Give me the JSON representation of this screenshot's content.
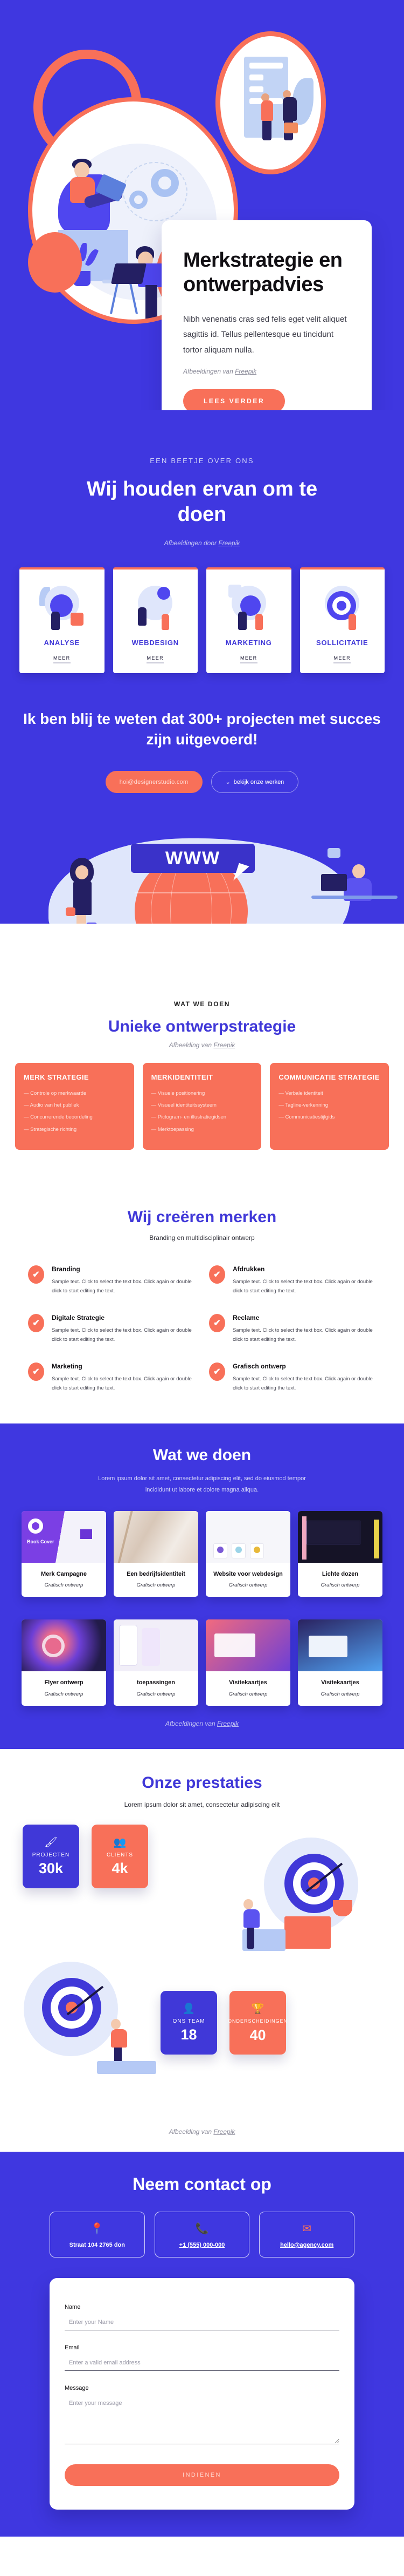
{
  "hero": {
    "title": "Merkstrategie en ontwerpadvies",
    "paragraph": "Nibh venenatis cras sed felis eget velit aliquet sagittis id. Tellus pellentesque eu tincidunt tortor aliquam nulla.",
    "credit_prefix": "Afbeeldingen van ",
    "credit_link": "Freepik",
    "cta_label": "LEES VERDER"
  },
  "about": {
    "eyebrow": "EEN BEETJE OVER ONS",
    "title": "Wij houden ervan om te doen",
    "credit_prefix": "Afbeeldingen door ",
    "credit_link": "Freepik",
    "services": [
      {
        "name": "ANALYSE",
        "more": "MEER"
      },
      {
        "name": "WEBDESIGN",
        "more": "MEER"
      },
      {
        "name": "MARKETING",
        "more": "MEER"
      },
      {
        "name": "SOLLICITATIE",
        "more": "MEER"
      }
    ]
  },
  "cta": {
    "title": "Ik ben blij te weten dat 300+ projecten met succes zijn uitgevoerd!",
    "email_button": "hoi@designerstudio.com",
    "works_button": "bekijk onze werken"
  },
  "www_band": {
    "wordmark": "WWW"
  },
  "strategy": {
    "eyebrow": "WAT WE DOEN",
    "title": "Unieke ontwerpstrategie",
    "credit_prefix": "Afbeelding van ",
    "credit_link": "Freepik",
    "cards": [
      {
        "title": "MERK STRATEGIE",
        "items": [
          "Controle op merkwaarde",
          "Audio van het publiek",
          "Concurrerende beoordeling",
          "Strategische richting"
        ]
      },
      {
        "title": "MERKIDENTITEIT",
        "items": [
          "Visuele positionering",
          "Visueel identiteitssysteem",
          "Pictogram- en illustratiegidsen",
          "Merktoepassing"
        ]
      },
      {
        "title": "COMMUNICATIE STRATEGIE",
        "items": [
          "Verbale identiteit",
          "Tagline-verkenning",
          "Communicatiestijlgids"
        ]
      }
    ]
  },
  "create": {
    "title": "Wij creëren merken",
    "subtitle": "Branding en multidisciplinair ontwerp",
    "body": "Sample text. Click to select the text box. Click again or double click to start editing the text.",
    "features": [
      {
        "title": "Branding"
      },
      {
        "title": "Afdrukken"
      },
      {
        "title": "Digitale Strategie"
      },
      {
        "title": "Reclame"
      },
      {
        "title": "Marketing"
      },
      {
        "title": "Grafisch ontwerp"
      }
    ]
  },
  "portfolio": {
    "title": "Wat we doen",
    "subtitle": "Lorem ipsum dolor sit amet, consectetur adipiscing elit, sed do eiusmod tempor incididunt ut labore et dolore magna aliqua.",
    "credit_prefix": "Afbeeldingen van ",
    "credit_link": "Freepik",
    "items": [
      {
        "title": "Merk Campagne",
        "category": "Grafisch ontwerp",
        "thumb": "th-bookcover",
        "thumb_label": "Book Cover"
      },
      {
        "title": "Een bedrijfsidentiteit",
        "category": "Grafisch ontwerp",
        "thumb": "th-marble"
      },
      {
        "title": "Website voor webdesign",
        "category": "Grafisch ontwerp",
        "thumb": "th-web"
      },
      {
        "title": "Lichte dozen",
        "category": "Grafisch ontwerp",
        "thumb": "th-dark"
      },
      {
        "title": "Flyer ontwerp",
        "category": "Grafisch ontwerp",
        "thumb": "th-flyer"
      },
      {
        "title": "toepassingen",
        "category": "Grafisch ontwerp",
        "thumb": "th-app"
      },
      {
        "title": "Visitekaartjes",
        "category": "Grafisch ontwerp",
        "thumb": "th-card1"
      },
      {
        "title": "Visitekaartjes",
        "category": "Grafisch ontwerp",
        "thumb": "th-card2"
      }
    ]
  },
  "stats": {
    "title": "Onze prestaties",
    "subtitle": "Lorem ipsum dolor sit amet, consectetur adipiscing elit",
    "credit_prefix": "Afbeelding van ",
    "credit_link": "Freepik",
    "cards": [
      {
        "label": "PROJECTEN",
        "value": "30k",
        "icon": "design-monitor-icon",
        "color": "#4038d8"
      },
      {
        "label": "CLIENTS",
        "value": "4k",
        "icon": "people-icon",
        "color": "#f87059"
      },
      {
        "label": "ONS TEAM",
        "value": "18",
        "icon": "team-icon",
        "color": "#4038d8"
      },
      {
        "label": "ONDERSCHEIDINGEN",
        "value": "40",
        "icon": "award-icon",
        "color": "#f87059"
      }
    ]
  },
  "contact": {
    "title": "Neem contact op",
    "cards": [
      {
        "icon": "location-pin-icon",
        "text": "Straat 104 2765 don",
        "underline": false
      },
      {
        "icon": "phone-icon",
        "text": "+1 (555) 000-000",
        "underline": true
      },
      {
        "icon": "envelope-icon",
        "text": "hello@agency.com",
        "underline": true
      }
    ],
    "form": {
      "name_label": "Name",
      "name_placeholder": "Enter your Name",
      "email_label": "Email",
      "email_placeholder": "Enter a valid email address",
      "message_label": "Message",
      "message_placeholder": "Enter your message",
      "submit_label": "INDIENEN"
    }
  },
  "colors": {
    "brand_blue": "#3f37e0",
    "accent_coral": "#f87059",
    "deep_blue": "#4038d8"
  }
}
